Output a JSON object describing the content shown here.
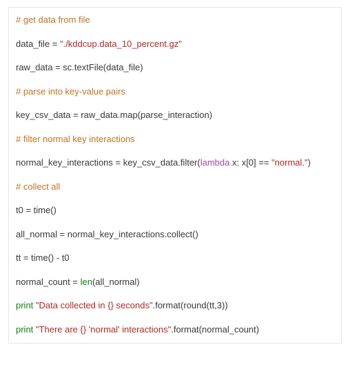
{
  "code": {
    "c1": "# get data from file",
    "l1a": "data_file = ",
    "l1s": "\"./kddcup.data_10_percent.gz\"",
    "l2": "raw_data = sc.textFile(data_file)",
    "c2": "# parse into key-value pairs",
    "l3": "key_csv_data = raw_data.map(parse_interaction)",
    "c3": "# filter normal key interactions",
    "l4a": "normal_key_interactions = key_csv_data.filter(",
    "l4b": "lambda",
    "l4c": " x: x[0] == ",
    "l4s": "\"normal.\"",
    "l4d": ")",
    "c4": "# collect all",
    "l5": "t0 = time()",
    "l6": "all_normal = normal_key_interactions.collect()",
    "l7": "tt = time() - t0",
    "l8a": "normal_count = ",
    "l8b": "len",
    "l8c": "(all_normal)",
    "l9a": "print",
    "l9b": " ",
    "l9s": "\"Data collected in {} seconds\"",
    "l9c": ".format(round(tt,3))",
    "l10a": "print",
    "l10b": " ",
    "l10s": "\"There are {} 'normal' interactions\"",
    "l10c": ".format(normal_count)"
  }
}
